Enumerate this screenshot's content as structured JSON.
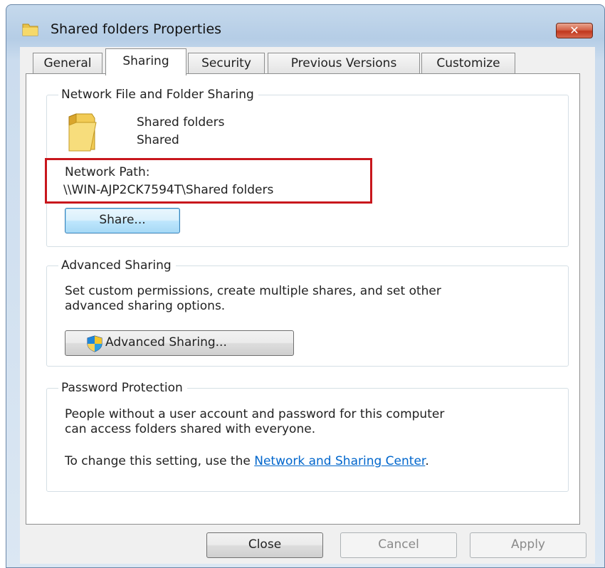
{
  "window": {
    "title": "Shared folders Properties",
    "close_glyph": "✕"
  },
  "tabs": [
    {
      "label": "General",
      "active": false
    },
    {
      "label": "Sharing",
      "active": true
    },
    {
      "label": "Security",
      "active": false
    },
    {
      "label": "Previous Versions",
      "active": false
    },
    {
      "label": "Customize",
      "active": false
    }
  ],
  "network_sharing": {
    "group_title": "Network File and Folder Sharing",
    "folder_name": "Shared folders",
    "folder_status": "Shared",
    "path_label": "Network Path:",
    "path_value": "\\\\WIN-AJP2CK7594T\\Shared folders",
    "share_button": "Share..."
  },
  "advanced_sharing": {
    "group_title": "Advanced Sharing",
    "description_line1": "Set custom permissions, create multiple shares, and set other",
    "description_line2": "advanced sharing options.",
    "button": "Advanced Sharing..."
  },
  "password_protection": {
    "group_title": "Password Protection",
    "description_line1": "People without a user account and password for this computer",
    "description_line2": "can access folders shared with everyone.",
    "change_prefix": "To change this setting, use the ",
    "link_text": "Network and Sharing Center",
    "change_suffix": "."
  },
  "footer": {
    "close": "Close",
    "cancel": "Cancel",
    "apply": "Apply"
  },
  "icons": {
    "folder": "folder-icon",
    "shield": "uac-shield-icon",
    "close": "close-icon"
  },
  "colors": {
    "highlight_border": "#c8171d",
    "link": "#0066cc"
  }
}
